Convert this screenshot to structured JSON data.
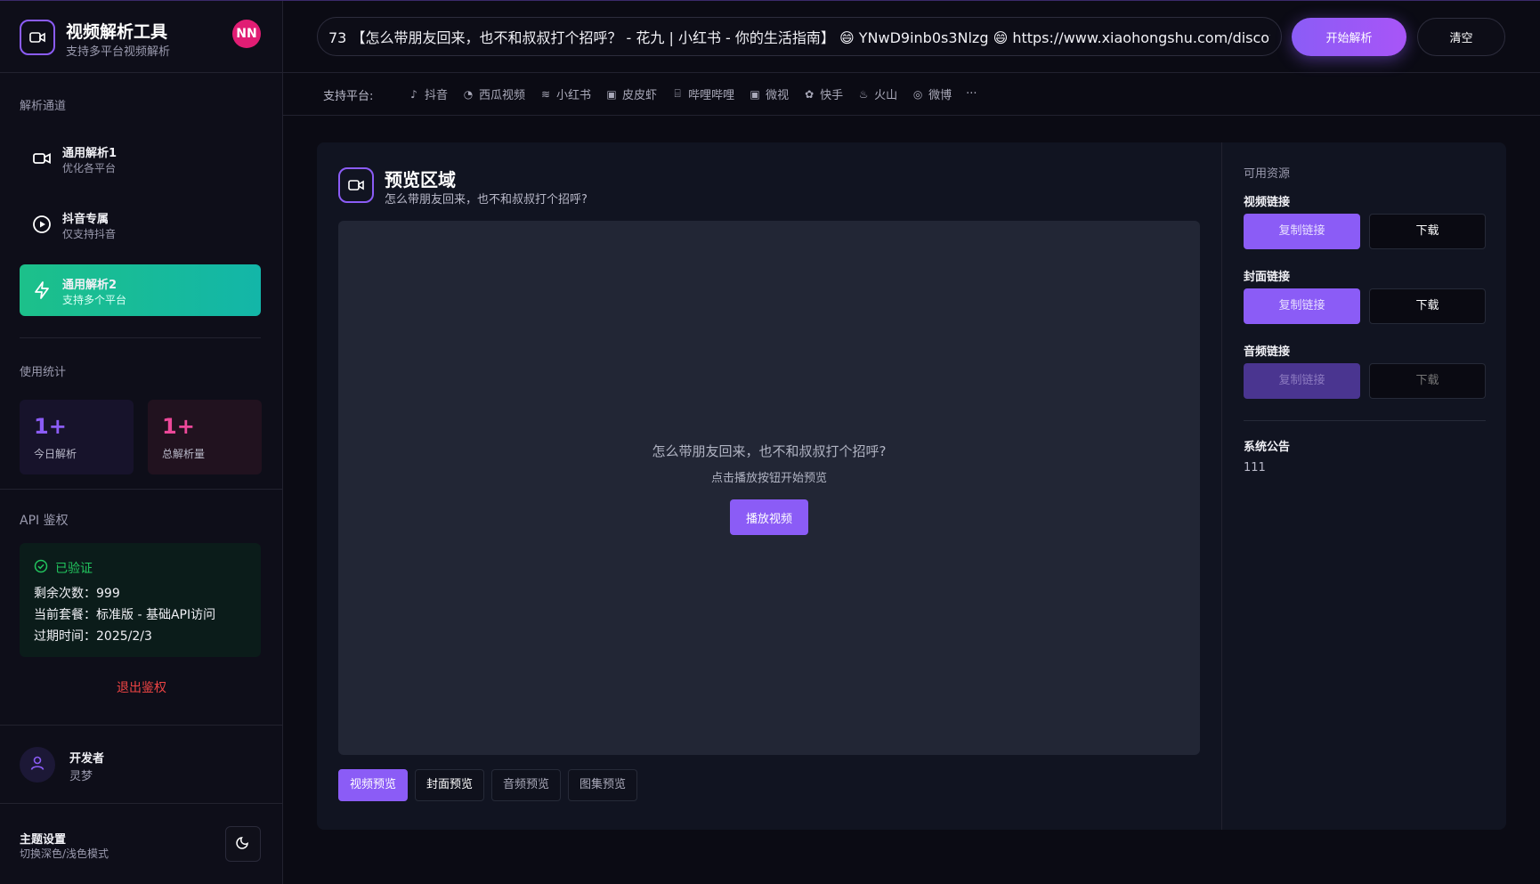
{
  "brand": {
    "title": "视频解析工具",
    "subtitle": "支持多平台视频解析",
    "avatar": "NN"
  },
  "channels": {
    "label": "解析通道",
    "items": [
      {
        "title": "通用解析1",
        "sub": "优化各平台",
        "icon": "video-icon",
        "active": false
      },
      {
        "title": "抖音专属",
        "sub": "仅支持抖音",
        "icon": "play-circle-icon",
        "active": true
      },
      {
        "title": "通用解析2",
        "sub": "支持多个平台",
        "icon": "lightning-icon",
        "active": true
      }
    ]
  },
  "stats": {
    "label": "使用统计",
    "today": {
      "value": "1+",
      "label": "今日解析",
      "color": "#8b5cf6"
    },
    "total": {
      "value": "1+",
      "label": "总解析量",
      "color": "#ec4899"
    }
  },
  "api": {
    "label": "API 鉴权",
    "status": "已验证",
    "remaining": "剩余次数：999",
    "plan": "当前套餐：标准版 - 基础API访问",
    "expire": "过期时间：2025/2/3",
    "logout": "退出鉴权"
  },
  "developer": {
    "name": "开发者",
    "role": "灵梦"
  },
  "theme": {
    "title": "主题设置",
    "subtitle": "切换深色/浅色模式"
  },
  "topbar": {
    "url_value": "73 【怎么带朋友回来，也不和叔叔打个招呼？ - 花九 | 小红书 - 你的生活指南】 😄 YNwD9inb0s3Nlzg 😄 https://www.xiaohongshu.com/discovery/item/",
    "parse_button": "开始解析",
    "clear_button": "清空"
  },
  "platforms": {
    "label": "支持平台:",
    "items": [
      {
        "name": "抖音",
        "icon": "tiktok-icon",
        "glyph": "♪"
      },
      {
        "name": "西瓜视频",
        "icon": "xigua-icon",
        "glyph": "◔"
      },
      {
        "name": "小红书",
        "icon": "xiaohongshu-icon",
        "glyph": "≋"
      },
      {
        "name": "皮皮虾",
        "icon": "pipixia-icon",
        "glyph": "▣"
      },
      {
        "name": "哔哩哔哩",
        "icon": "bilibili-icon",
        "glyph": "⌸"
      },
      {
        "name": "微视",
        "icon": "weishi-icon",
        "glyph": "▣"
      },
      {
        "name": "快手",
        "icon": "kuaishou-icon",
        "glyph": "✿"
      },
      {
        "name": "火山",
        "icon": "huoshan-icon",
        "glyph": "♨"
      },
      {
        "name": "微博",
        "icon": "weibo-icon",
        "glyph": "◎"
      }
    ],
    "more": "···"
  },
  "preview": {
    "title": "预览区域",
    "subtitle": "怎么带朋友回来，也不和叔叔打个招呼?",
    "player_title": "怎么带朋友回来，也不和叔叔打个招呼?",
    "player_hint": "点击播放按钮开始预览",
    "play_button": "播放视频",
    "tabs": [
      "视频预览",
      "封面预览",
      "音频预览",
      "图集预览"
    ]
  },
  "resources": {
    "heading": "可用资源",
    "groups": [
      {
        "label": "视频链接",
        "copy": "复制链接",
        "download": "下载",
        "enabled": true
      },
      {
        "label": "封面链接",
        "copy": "复制链接",
        "download": "下载",
        "enabled": true
      },
      {
        "label": "音频链接",
        "copy": "复制链接",
        "download": "下载",
        "enabled": false
      }
    ],
    "notice_heading": "系统公告",
    "notice_text": "111"
  },
  "colors": {
    "accent": "#8b5cf6",
    "active_channel": "#14b8a6",
    "verified": "#22c55e",
    "danger": "#ef4444"
  }
}
